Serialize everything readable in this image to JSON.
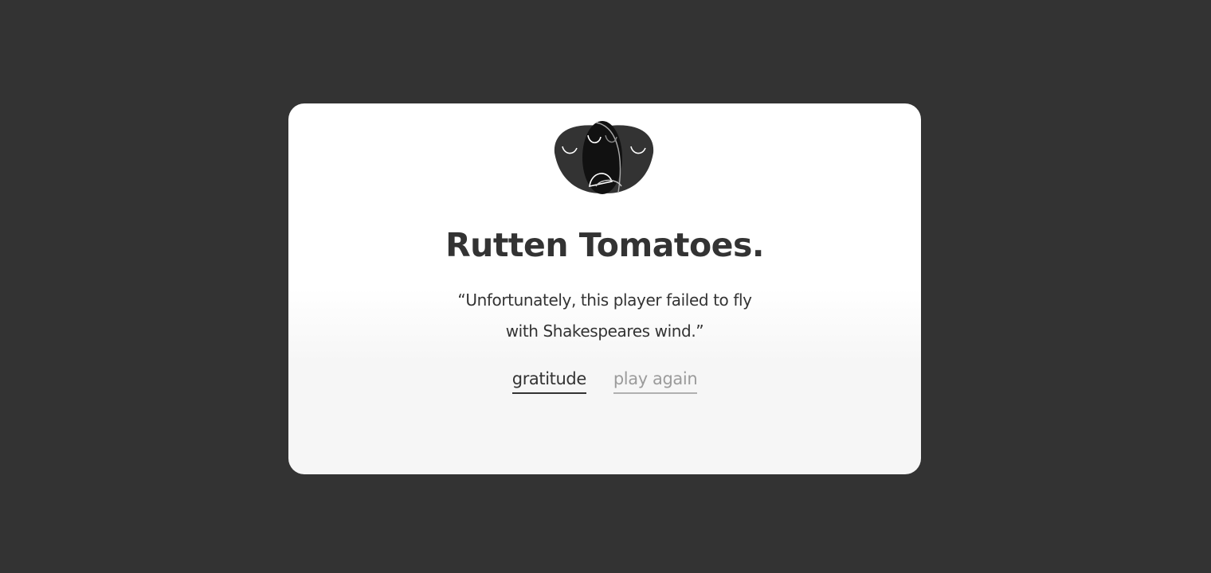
{
  "game": {
    "logo_icon": "theatre-masks-icon",
    "title": "Rutten Tomatoes.",
    "quote_line1": "“Unfortunately, this player failed to fly",
    "quote_line2": "with Shakespeares wind.”",
    "links": {
      "gratitude": "gratitude",
      "play_again": "play again"
    }
  },
  "colors": {
    "background": "#333333",
    "card": "#ffffff",
    "text": "#333333",
    "muted": "#9b9b9b"
  }
}
